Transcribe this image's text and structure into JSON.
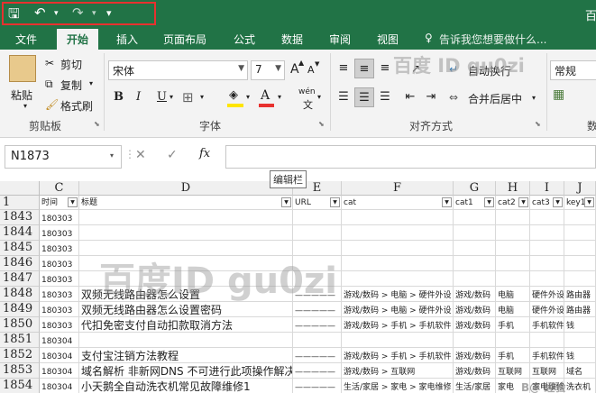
{
  "window": {
    "title_fragment": "百"
  },
  "qat": {
    "save_glyph": "🖫",
    "undo_glyph": "↶",
    "redo_glyph": "↷",
    "customize_glyph": "▾"
  },
  "tabs": [
    "文件",
    "开始",
    "插入",
    "页面布局",
    "公式",
    "数据",
    "审阅",
    "视图"
  ],
  "tell_me": "告诉我您想要做什么...",
  "ribbon": {
    "paste": "粘贴",
    "cut": "剪切",
    "copy": "复制",
    "format_painter": "格式刷",
    "clipboard_group": "剪贴板",
    "font_name": "宋体",
    "font_size": "7",
    "grow": "A",
    "shrink": "A",
    "bold": "B",
    "italic": "I",
    "underline": "U",
    "wen": "wén",
    "font_group": "字体",
    "wrap_text": "自动换行",
    "merge_center": "合并后居中",
    "align_group": "对齐方式",
    "number_format": "常规",
    "number_group": "数"
  },
  "formula_bar": {
    "name_box": "N1873",
    "fx": "fx",
    "value": "",
    "tooltip": "编辑栏"
  },
  "watermark": {
    "text": "百度ID gu0zi",
    "ribbon_text": "百度 ID gu0zi",
    "corner": "B@ 经验"
  },
  "columns": [
    "C",
    "D",
    "E",
    "F",
    "G",
    "H",
    "I",
    "J"
  ],
  "header_row": {
    "num": "1",
    "cells": [
      "时间",
      "标题",
      "URL",
      "cat",
      "cat1",
      "cat2",
      "cat3",
      "key1"
    ]
  },
  "rows": [
    {
      "num": "1843",
      "cells": [
        "180303",
        "",
        "",
        "",
        "",
        "",
        "",
        ""
      ]
    },
    {
      "num": "1844",
      "cells": [
        "180303",
        "",
        "",
        "",
        "",
        "",
        "",
        ""
      ]
    },
    {
      "num": "1845",
      "cells": [
        "180303",
        "",
        "",
        "",
        "",
        "",
        "",
        ""
      ]
    },
    {
      "num": "1846",
      "cells": [
        "180303",
        "",
        "",
        "",
        "",
        "",
        "",
        ""
      ]
    },
    {
      "num": "1847",
      "cells": [
        "180303",
        "",
        "",
        "",
        "",
        "",
        "",
        ""
      ]
    },
    {
      "num": "1848",
      "cells": [
        "180303",
        "双频无线路由器怎么设置",
        "—————",
        "游戏/数码 > 电脑 > 硬件外设",
        "游戏/数码",
        "电脑",
        "硬件外设",
        "路由器"
      ]
    },
    {
      "num": "1849",
      "cells": [
        "180303",
        "双频无线路由器怎么设置密码",
        "—————",
        "游戏/数码 > 电脑 > 硬件外设",
        "游戏/数码",
        "电脑",
        "硬件外设",
        "路由器"
      ]
    },
    {
      "num": "1850",
      "cells": [
        "180303",
        "代扣免密支付自动扣款取消方法",
        "—————",
        "游戏/数码 > 手机 > 手机软件",
        "游戏/数码",
        "手机",
        "手机软件",
        "钱"
      ]
    },
    {
      "num": "1851",
      "cells": [
        "180304",
        "",
        "",
        "",
        "",
        "",
        "",
        ""
      ]
    },
    {
      "num": "1852",
      "cells": [
        "180304",
        "支付宝注销方法教程",
        "—————",
        "游戏/数码 > 手机 > 手机软件",
        "游戏/数码",
        "手机",
        "手机软件",
        "钱"
      ]
    },
    {
      "num": "1853",
      "cells": [
        "180304",
        "域名解析 非新网DNS 不可进行此项操作解决方法",
        "—————",
        "游戏/数码 > 互联网",
        "游戏/数码",
        "互联网",
        "互联网",
        "域名"
      ]
    },
    {
      "num": "1854",
      "cells": [
        "180304",
        "小天鹅全自动洗衣机常见故障维修1",
        "—————",
        "生活/家居 > 家电 > 家电维修",
        "生活/家居",
        "家电",
        "家电维修",
        "洗衣机"
      ]
    }
  ]
}
